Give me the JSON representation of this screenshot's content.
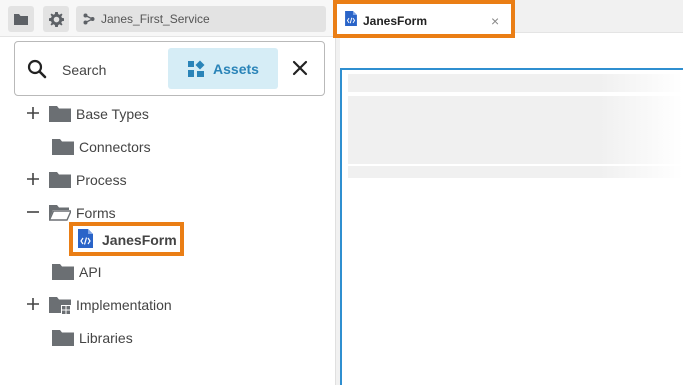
{
  "toolbar": {
    "service_name": "Janes_First_Service"
  },
  "search": {
    "label": "Search",
    "assets_label": "Assets"
  },
  "tree": {
    "items": [
      {
        "label": "Base Types"
      },
      {
        "label": "Connectors"
      },
      {
        "label": "Process"
      },
      {
        "label": "Forms"
      },
      {
        "label": "JanesForm"
      },
      {
        "label": "API"
      },
      {
        "label": "Implementation"
      },
      {
        "label": "Libraries"
      }
    ]
  },
  "editor": {
    "tab_label": "JanesForm",
    "tab_close": "×"
  },
  "colors": {
    "highlight": "#ea7e15",
    "accent": "#2a84b8",
    "canvas_border": "#2f8fd0",
    "form_icon": "#2a64c8",
    "folder": "#6b6f73"
  },
  "icons": [
    "folder-icon",
    "gear-icon",
    "service-icon",
    "search-icon",
    "assets-icon",
    "close-icon",
    "plus-icon",
    "minus-icon",
    "folder-open-icon",
    "form-file-icon",
    "implementation-folder-icon"
  ]
}
